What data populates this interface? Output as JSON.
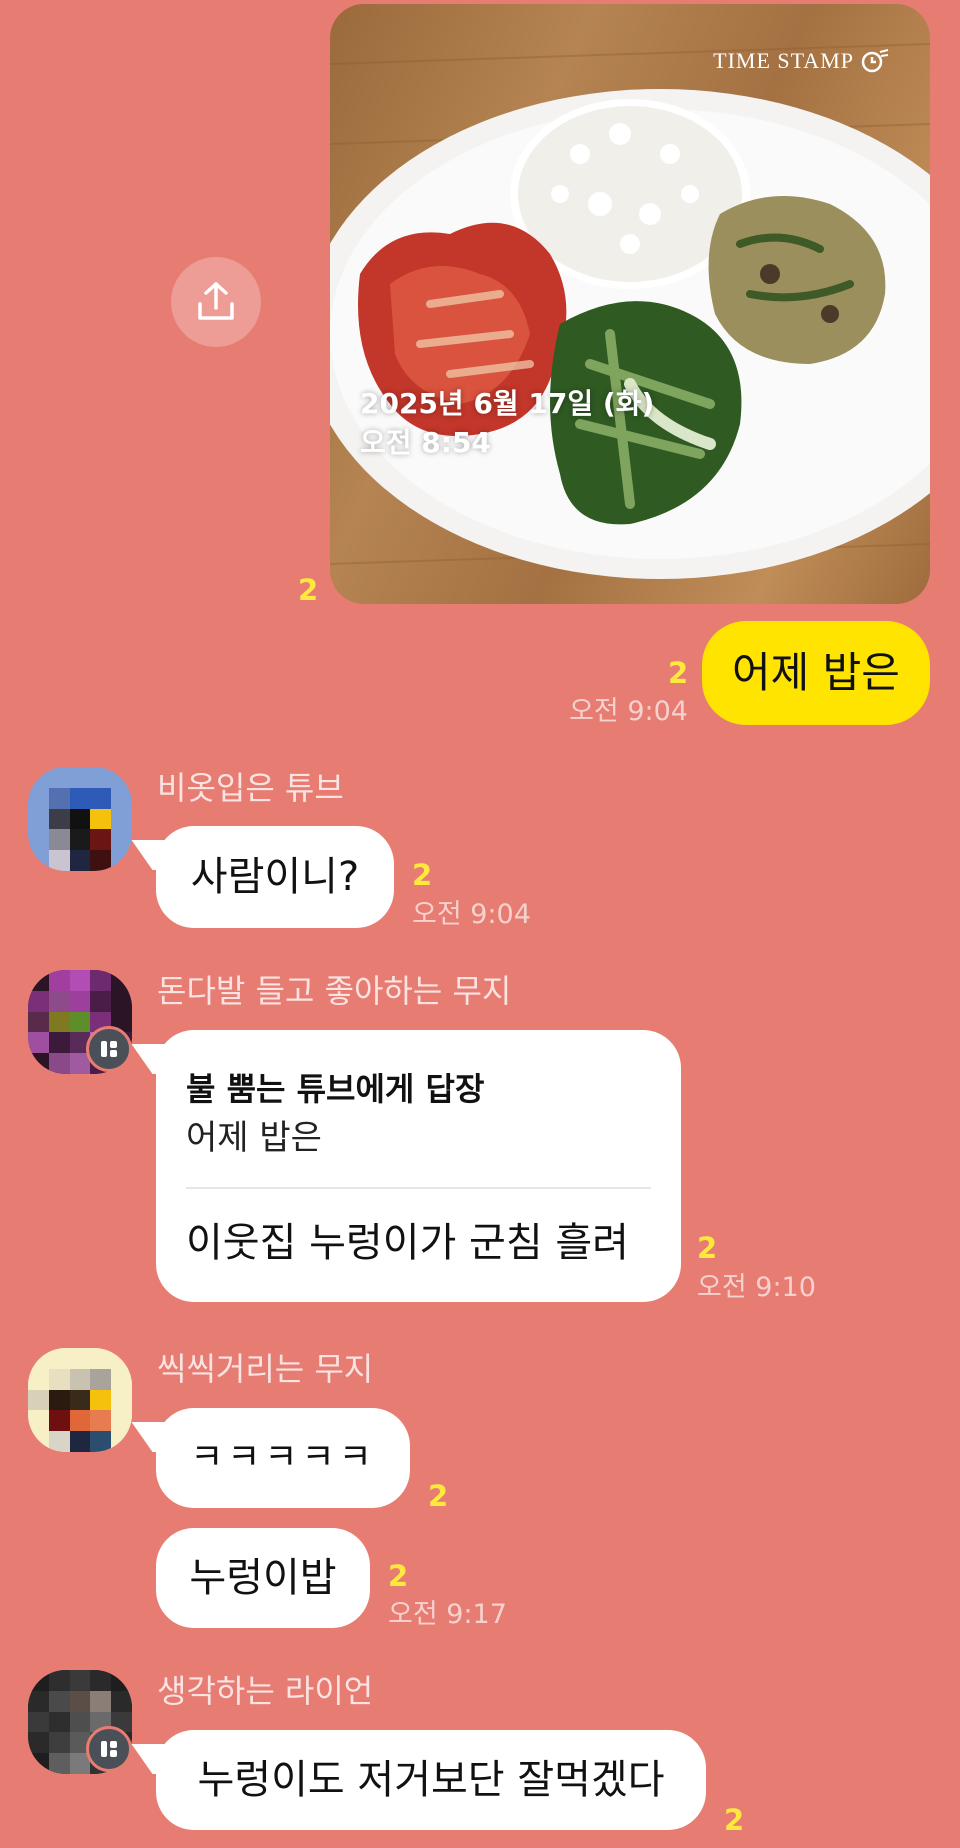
{
  "colors": {
    "background": "#E77C73",
    "my_bubble": "#FFE400",
    "other_bubble": "#FFFFFF",
    "unread": "#FFE93E"
  },
  "photo_message": {
    "unread": "2",
    "watermark": "TIME STAMP",
    "date_stamp": "2025년 6월 17일 (화)",
    "time_stamp": "오전 8:54",
    "share_icon": "upload-share-icon"
  },
  "my_message": {
    "text": "어제 밥은",
    "unread": "2",
    "time": "오전 9:04"
  },
  "messages": [
    {
      "sender": "비옷입은 튜브",
      "text": "사람이니?",
      "unread": "2",
      "time": "오전 9:04"
    },
    {
      "sender": "돈다발 들고 좋아하는 무지",
      "reply_to": "불 뿜는 튜브에게 답장",
      "quoted": "어제 밥은",
      "text": "이웃집 누렁이가 군침 흘려",
      "unread": "2",
      "time": "오전 9:10"
    },
    {
      "sender": "씩씩거리는 무지",
      "text": "ㅋㅋㅋㅋㅋ",
      "unread": "2"
    },
    {
      "text": "누렁이밥",
      "unread": "2",
      "time": "오전 9:17"
    },
    {
      "sender": "생각하는 라이언",
      "text": "누렁이도 저거보단 잘먹겠다",
      "unread": "2"
    }
  ]
}
